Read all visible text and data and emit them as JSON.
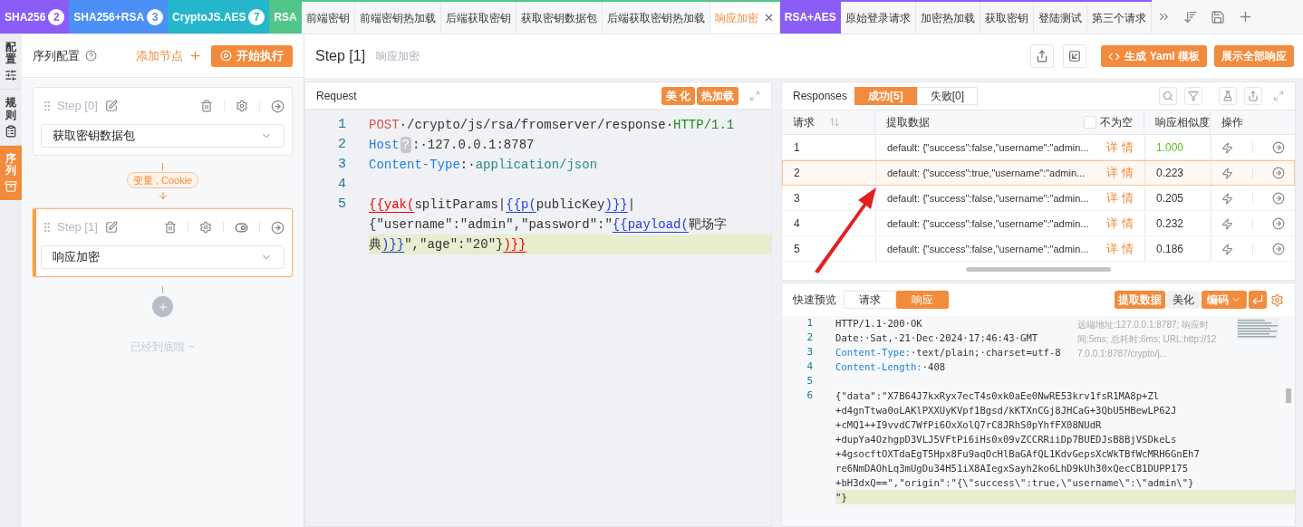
{
  "tab_bar": {
    "groups": [
      {
        "label": "SHA256",
        "count": "2",
        "color": "#8b5cf6"
      },
      {
        "label": "SHA256+RSA",
        "count": "3",
        "color": "#4c8ff5"
      },
      {
        "label": "CryptoJS.AES",
        "count": "7",
        "color": "#26b6cb"
      },
      {
        "label": "RSA",
        "color": "#52c58a",
        "tabs": [
          {
            "label": "前端密钥",
            "selected": false
          },
          {
            "label": "前端密钥热加载",
            "selected": false
          },
          {
            "label": "后端获取密钥",
            "selected": false
          },
          {
            "label": "获取密钥数据包",
            "selected": false
          },
          {
            "label": "后端获取密钥热加载",
            "selected": false
          },
          {
            "label": "响应加密",
            "selected": true
          }
        ]
      },
      {
        "label": "RSA+AES",
        "color": "#8b5cf6",
        "tabs": [
          {
            "label": "原始登录请求",
            "selected": false
          },
          {
            "label": "加密热加载",
            "selected": false
          },
          {
            "label": "获取密钥",
            "selected": false
          },
          {
            "label": "登陆测试",
            "selected": false
          },
          {
            "label": "第三个请求",
            "selected": false
          }
        ]
      }
    ]
  },
  "side_strip": [
    {
      "label": "配置",
      "kind": "sliders",
      "selected": false
    },
    {
      "label": "规则",
      "kind": "clipboard",
      "selected": false
    },
    {
      "label": "序列",
      "kind": "stack",
      "selected": true
    }
  ],
  "sequence": {
    "title": "序列配置",
    "add_node": "添加节点",
    "run": "开始执行",
    "steps": [
      {
        "title": "Step [0]",
        "value": "获取密钥数据包",
        "selected": false,
        "toggle": false
      },
      {
        "title": "Step [1]",
        "value": "响应加密",
        "selected": true,
        "toggle": true
      }
    ],
    "connector": "变量 , Cookie",
    "end_text": "已经到底啦 ~"
  },
  "header": {
    "title": "Step [1]",
    "subtitle": "响应加密",
    "yaml_button": "生成 Yaml 模板",
    "show_all_button": "展示全部响应"
  },
  "request": {
    "title": "Request",
    "buttons": [
      "美 化",
      "热加载"
    ],
    "lines": [
      {
        "num": "1",
        "rows": [
          {
            "segments": [
              {
                "kind": "method",
                "text": "POST"
              },
              {
                "kind": "plain",
                "text": "·/crypto/js/rsa/fromserver/response·"
              },
              {
                "kind": "version",
                "text": "HTTP/1.1"
              }
            ]
          }
        ]
      },
      {
        "num": "2",
        "rows": [
          {
            "segments": [
              {
                "kind": "key",
                "text": "Host"
              },
              {
                "kind": "hint",
                "text": "?"
              },
              {
                "kind": "plain",
                "text": ":·127.0.0.1:8787"
              }
            ]
          }
        ]
      },
      {
        "num": "3",
        "rows": [
          {
            "segments": [
              {
                "kind": "key",
                "text": "Content-Type"
              },
              {
                "kind": "plain",
                "text": ":·"
              },
              {
                "kind": "value",
                "text": "application/json"
              }
            ]
          }
        ]
      },
      {
        "num": "4"
      },
      {
        "num": "5",
        "active": true,
        "rows": [
          {
            "segments": [
              {
                "kind": "tpl-red",
                "text": "{{yak("
              },
              {
                "kind": "plain",
                "text": "splitParams|"
              },
              {
                "kind": "tpl-blue",
                "text": "{{p("
              },
              {
                "kind": "plain",
                "text": "publicKey"
              },
              {
                "kind": "tpl-blue",
                "text": ")}}"
              },
              {
                "kind": "plain",
                "text": "|"
              }
            ]
          },
          {
            "segments": [
              {
                "kind": "plain",
                "text": "{\"username\":\"admin\",\"password\":\""
              },
              {
                "kind": "tpl-blue",
                "text": "{{payload("
              },
              {
                "kind": "plain",
                "text": "靶场字"
              }
            ]
          },
          {
            "segments": [
              {
                "kind": "plain",
                "text": "典"
              },
              {
                "kind": "tpl-blue",
                "text": ")}}"
              },
              {
                "kind": "plain",
                "text": "\",\"age\":\"20\"}"
              },
              {
                "kind": "tpl-red",
                "text": ")}}"
              }
            ]
          }
        ]
      }
    ]
  },
  "responses": {
    "title": "Responses",
    "tabs": [
      {
        "label": "成功[5]",
        "selected": true
      },
      {
        "label": "失败[0]",
        "selected": false
      }
    ],
    "columns": [
      "请求",
      "提取数据",
      "响应相似度",
      "操作"
    ],
    "not_empty_filter": {
      "label": "不为空",
      "checked": false
    },
    "rows": [
      {
        "id": "1",
        "data": "default: {\"success\":false,\"username\":\"admin...",
        "detail": "详 情",
        "similarity": "1.000",
        "color": "#52c41a",
        "selected": false
      },
      {
        "id": "2",
        "data": "default: {\"success\":true,\"username\":\"admin...",
        "detail": "详 情",
        "similarity": "0.223",
        "color": "#333333",
        "selected": true
      },
      {
        "id": "3",
        "data": "default: {\"success\":false,\"username\":\"admin...",
        "detail": "详 情",
        "similarity": "0.205",
        "color": "#333333",
        "selected": false
      },
      {
        "id": "4",
        "data": "default: {\"success\":false,\"username\":\"admin...",
        "detail": "详 情",
        "similarity": "0.232",
        "color": "#333333",
        "selected": false
      },
      {
        "id": "5",
        "data": "default: {\"success\":false,\"username\":\"admin...",
        "detail": "详 情",
        "similarity": "0.186",
        "color": "#333333",
        "selected": false
      }
    ]
  },
  "preview": {
    "title": "快速预览",
    "tabs": [
      {
        "label": "请求",
        "selected": false
      },
      {
        "label": "响应",
        "selected": true
      }
    ],
    "extract_button": "提取数据",
    "beautify_button": "美化",
    "encode_button": "编码",
    "info": "远端地址:127.0.0.1:8787; 响应时间:5ms; 总耗时:6ms; URL:http://127.0.0.1:8787/crypto/j...",
    "lines": [
      {
        "num": "1",
        "rows": [
          {
            "segments": [
              {
                "kind": "plain",
                "text": "HTTP/1.1·200·OK"
              }
            ]
          }
        ]
      },
      {
        "num": "2",
        "rows": [
          {
            "segments": [
              {
                "kind": "plain",
                "text": "Date:·Sat,·21·Dec·2024·17:46:43·GMT"
              }
            ]
          }
        ]
      },
      {
        "num": "3",
        "rows": [
          {
            "segments": [
              {
                "kind": "key",
                "text": "Content-Type:"
              },
              {
                "kind": "plain",
                "text": "·text/plain;·charset=utf-8"
              }
            ]
          }
        ]
      },
      {
        "num": "4",
        "rows": [
          {
            "segments": [
              {
                "kind": "key",
                "text": "Content-Length:"
              },
              {
                "kind": "plain",
                "text": "·408"
              }
            ]
          }
        ]
      },
      {
        "num": "5"
      },
      {
        "num": "6",
        "active": true,
        "rows": [
          {
            "segments": [
              {
                "kind": "plain",
                "text": "{\"data\":\"X7B64J7kxRyx7ecT4s0xk0aEe0NwRE53krv1fsR1MA8p+Zl"
              }
            ]
          },
          {
            "segments": [
              {
                "kind": "plain",
                "text": "+d4gnTtwa0oLAKlPXXUyKVpf1Bgsd/kKTXnCGj8JHCaG+3QbU5HBewLP62J"
              }
            ]
          },
          {
            "segments": [
              {
                "kind": "plain",
                "text": "+cMQ1++I9vvdC7WfPi6OxXolQ7rC8JRhS0pYhfFX08NUdR"
              }
            ]
          },
          {
            "segments": [
              {
                "kind": "plain",
                "text": "+dupYa4OzhgpD3VLJ5VFtPi6iHs0x09vZCCRRiiDp7BUEDJsB8BjVSDkeLs"
              }
            ]
          },
          {
            "segments": [
              {
                "kind": "plain",
                "text": "+4gsocftOXTdaEgT5Hpx8Fu9aqOcHlBaGAfQL1KdvGepsXcWkTBfWcMRH6GnEh7"
              }
            ]
          },
          {
            "segments": [
              {
                "kind": "plain",
                "text": "re6NmDAOhLq3mUgDu34H51iX8AIegxSayh2ko6LhD9kUh30xQecCB1DUPP175"
              }
            ]
          },
          {
            "segments": [
              {
                "kind": "plain",
                "text": "+bH3dxQ==\",\"origin\":\"{\\\"success\\\":true,\\\"username\\\":\\\"admin\\\"}"
              }
            ]
          },
          {
            "segments": [
              {
                "kind": "plain",
                "text": "\"}"
              }
            ]
          }
        ]
      }
    ]
  }
}
